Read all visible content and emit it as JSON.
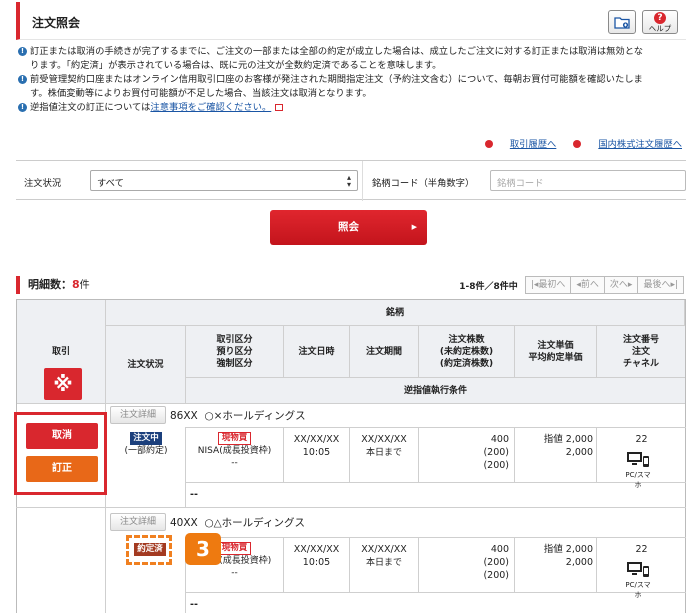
{
  "header": {
    "title": "注文照会",
    "help_label": "ヘルプ"
  },
  "notes": [
    {
      "text": "訂正または取消の手続きが完了するまでに、ご注文の一部または全部の約定が成立した場合は、成立したご注文に対する訂正または取消は無効とな"
    },
    {
      "text": "ります。「約定済」が表示されている場合は、既に元の注文が全数約定済であることを意味します。"
    },
    {
      "text": "前受管理契約口座またはオンライン信用取引口座のお客様が発注された期間指定注文（予約注文含む）について、毎朝お買付可能額を確認いたしま"
    },
    {
      "text": "す。株価変動等によりお買付可能額が不足した場合、当該注文は取消となります。"
    },
    {
      "pre": "逆指値注文の訂正については",
      "link": "注意事項をご確認ください。"
    }
  ],
  "links": {
    "history": "取引履歴へ",
    "domestic": "国内株式注文履歴へ"
  },
  "filter": {
    "status_label": "注文状況",
    "status_value": "すべて",
    "code_label": "銘柄コード（半角数字）",
    "code_placeholder": "銘柄コード"
  },
  "inquiry_button": "照会",
  "count": {
    "label": "明細数：",
    "value": "8",
    "unit": "件"
  },
  "pager": {
    "info": "1-8件／8件中",
    "first": "|◂最初へ",
    "prev": "◂前へ",
    "next": "次へ▸",
    "last": "最後へ▸|"
  },
  "table": {
    "h_torihiki": "取引",
    "h_meigara": "銘柄",
    "h_status": "注文状況",
    "h_kubun": "取引区分\n預り区分\n強制区分",
    "h_date": "注文日時",
    "h_period": "注文期間",
    "h_qty": "注文株数\n(未約定株数)\n(約定済株数)",
    "h_price": "注文単価\n平均約定単価",
    "h_no": "注文番号\n注文\nチャネル",
    "h_stop": "逆指値執行条件",
    "bulk_icon": "※"
  },
  "rows": [
    {
      "detail": "注文詳細",
      "code": "86XX",
      "name": "○×ホールディングス",
      "cancel": "取消",
      "modify": "訂正",
      "status": "注文中",
      "status_sub": "(一部約定)",
      "type": "現物買",
      "account": "NISA(成長投資枠)",
      "force": "--",
      "date": "XX/XX/XX",
      "time": "10:05",
      "period": "XX/XX/XX",
      "period_sub": "本日まで",
      "qty": "400",
      "unfilled": "(200)",
      "filled": "(200)",
      "price": "指値 2,000",
      "avg": "2,000",
      "no": "22",
      "channel": "PC/スマホ",
      "stop": "--"
    },
    {
      "detail": "注文詳細",
      "code": "40XX",
      "name": "○△ホールディングス",
      "status": "約定済",
      "type": "現物買",
      "account": "NISA(成長投資枠)",
      "force": "--",
      "date": "XX/XX/XX",
      "time": "10:05",
      "period": "XX/XX/XX",
      "period_sub": "本日まで",
      "qty": "400",
      "unfilled": "(200)",
      "filled": "(200)",
      "price": "指値 2,000",
      "avg": "2,000",
      "no": "22",
      "channel": "PC/スマホ",
      "stop": "--"
    }
  ],
  "step_label": "3"
}
